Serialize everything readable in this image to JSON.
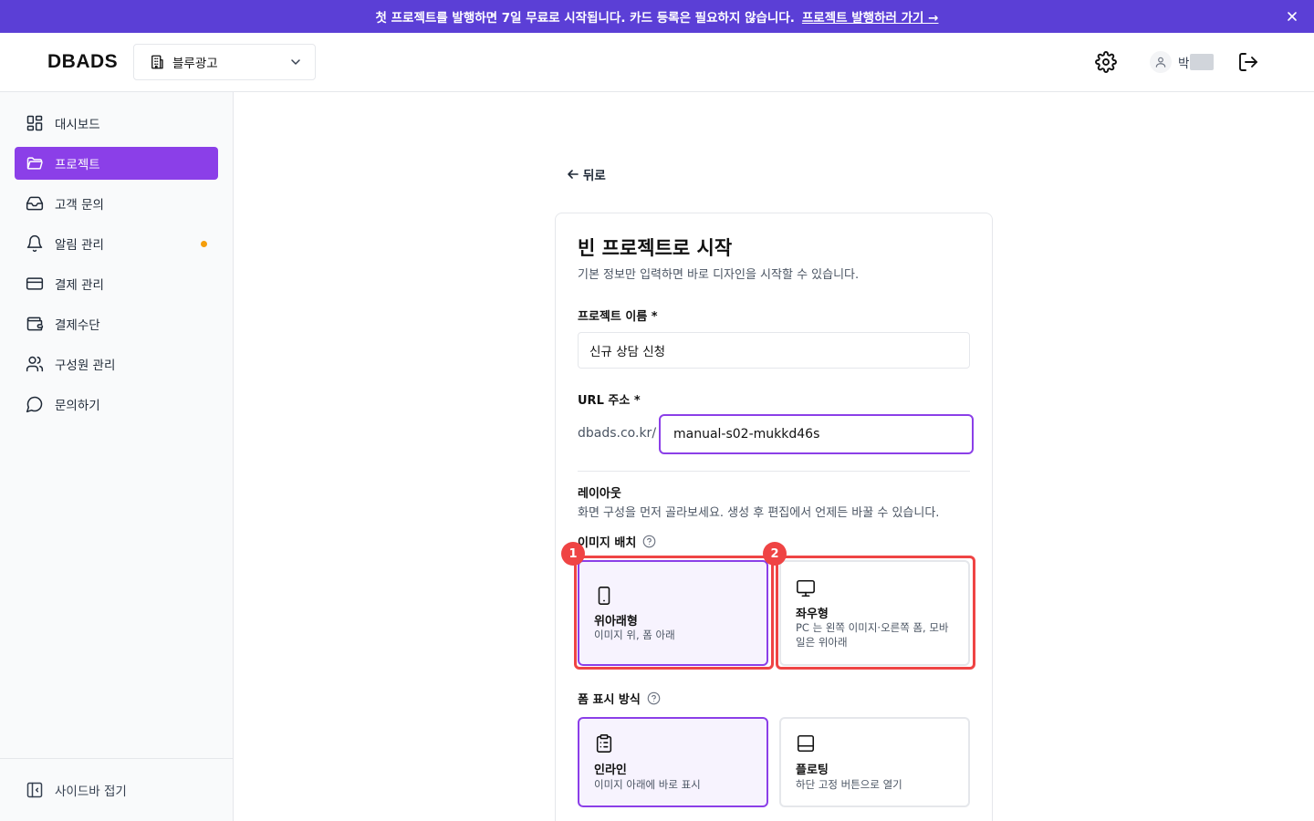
{
  "banner": {
    "message": "첫 프로젝트를 발행하면 7일 무료로 시작됩니다. 카드 등록은 필요하지 않습니다.",
    "link_label": "프로젝트 발행하러 가기 →"
  },
  "header": {
    "logo": "DBADS",
    "org_name": "블루광고",
    "user_name": "박"
  },
  "sidebar": {
    "items": [
      {
        "label": "대시보드",
        "icon": "dashboard-icon"
      },
      {
        "label": "프로젝트",
        "icon": "folder-icon",
        "active": true
      },
      {
        "label": "고객 문의",
        "icon": "inbox-icon"
      },
      {
        "label": "알림 관리",
        "icon": "bell-icon",
        "has_dot": true
      },
      {
        "label": "결제 관리",
        "icon": "credit-card-icon"
      },
      {
        "label": "결제수단",
        "icon": "wallet-icon"
      },
      {
        "label": "구성원 관리",
        "icon": "users-icon"
      },
      {
        "label": "문의하기",
        "icon": "chat-icon"
      }
    ],
    "collapse_label": "사이드바 접기"
  },
  "main": {
    "back_label": "뒤로",
    "card": {
      "title": "빈 프로젝트로 시작",
      "subtitle": "기본 정보만 입력하면 바로 디자인을 시작할 수 있습니다.",
      "name_label": "프로젝트 이름 *",
      "name_value": "신규 상담 신청",
      "url_label": "URL 주소 *",
      "url_prefix": "dbads.co.kr/",
      "url_value": "manual-s02-mukkd46s",
      "layout_title": "레이아웃",
      "layout_desc": "화면 구성을 먼저 골라보세요. 생성 후 편집에서 언제든 바꿀 수 있습니다.",
      "image_placement_label": "이미지 배치",
      "image_options": [
        {
          "title": "위아래형",
          "desc": "이미지 위, 폼 아래",
          "icon": "tablet-icon",
          "selected": true
        },
        {
          "title": "좌우형",
          "desc": "PC 는 왼쪽 이미지·오른쪽 폼, 모바일은 위아래",
          "icon": "monitor-icon",
          "selected": false
        }
      ],
      "form_display_label": "폼 표시 방식",
      "form_options": [
        {
          "title": "인라인",
          "desc": "이미지 아래에 바로 표시",
          "icon": "clipboard-icon",
          "selected": true
        },
        {
          "title": "플로팅",
          "desc": "하단 고정 버튼으로 열기",
          "icon": "panel-bottom-icon",
          "selected": false
        }
      ]
    }
  },
  "annotations": [
    "1",
    "2"
  ],
  "colors": {
    "accent": "#8b3fe8",
    "banner": "#5b3fd6",
    "highlight": "#ef4444",
    "dot": "#f59e0b"
  }
}
